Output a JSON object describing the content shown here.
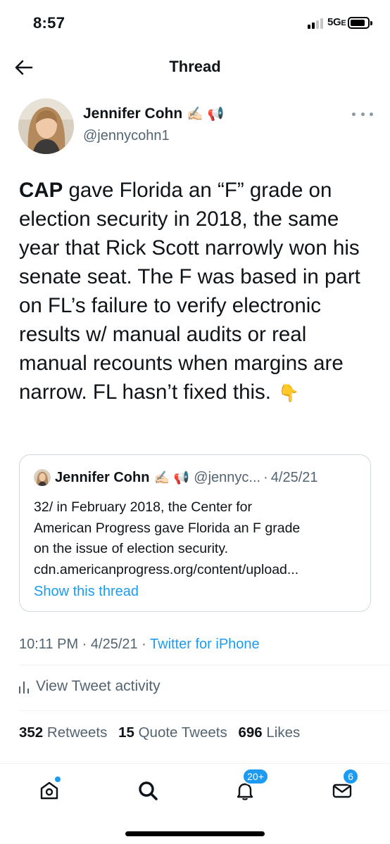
{
  "status_bar": {
    "time": "8:57",
    "network": "5G",
    "network_suffix": "E"
  },
  "header": {
    "title": "Thread",
    "back_icon": "arrow-left-icon"
  },
  "tweet": {
    "author_name": "Jennifer Cohn",
    "author_emoji": "✍🏻",
    "author_emoji2": "📢",
    "author_handle": "@jennycohn1",
    "text_bold": "CAP",
    "text_rest": " gave Florida an “F” grade on election security in 2018, the same year that Rick Scott narrowly won his senate seat. The F was based in part on FL’s failure to verify electronic results w/ manual audits or real manual recounts when margins are narrow. FL hasn’t fixed this.",
    "text_emoji": "👇",
    "timestamp": "10:11 PM · 4/25/21 ·",
    "source": "Twitter for iPhone"
  },
  "quoted": {
    "author_name": "Jennifer Cohn",
    "author_emoji": "✍🏻",
    "author_emoji2": "📢",
    "author_handle": "@jennyc...",
    "separator": "·",
    "date": "4/25/21",
    "lines": [
      "32/ in February 2018, the Center for",
      "American Progress gave Florida an F grade",
      "on the issue of election security.",
      "cdn.americanprogress.org/content/upload..."
    ],
    "show_thread": "Show this thread"
  },
  "activity": {
    "label": "View Tweet activity",
    "icon": "bar-chart-icon"
  },
  "stats": {
    "retweets_count": "352",
    "retweets_label": "Retweets",
    "quotes_count": "15",
    "quotes_label": "Quote Tweets",
    "likes_count": "696",
    "likes_label": "Likes"
  },
  "tabbar": {
    "notifications_badge": "20+",
    "messages_badge": "6",
    "icons": [
      "home-icon",
      "search-icon",
      "bell-icon",
      "mail-icon"
    ],
    "accent": "#1d9bf0"
  }
}
